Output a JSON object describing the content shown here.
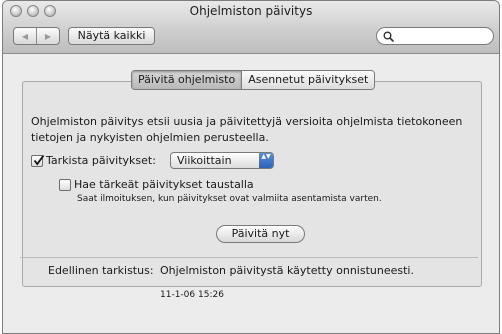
{
  "window": {
    "title": "Ohjelmiston päivitys"
  },
  "toolbar": {
    "back_glyph": "◀",
    "forward_glyph": "▶",
    "show_all_label": "Näytä kaikki",
    "search_value": ""
  },
  "tabs": [
    {
      "label": "Päivitä ohjelmisto",
      "selected": true
    },
    {
      "label": "Asennetut päivitykset",
      "selected": false
    }
  ],
  "update_tab": {
    "description": "Ohjelmiston päivitys etsii uusia ja päivitettyjä versioita ohjelmista tietokoneen tietojen ja nykyisten ohjelmien perusteella.",
    "check_updates": {
      "label": "Tarkista päivitykset:",
      "checked": true
    },
    "frequency": {
      "selected": "Viikoittain",
      "arrows": "▲▼"
    },
    "background_download": {
      "label": "Hae tärkeät päivitykset taustalla",
      "checked": false
    },
    "background_note": "Saat ilmoituksen, kun päivitykset ovat valmiita asentamista varten.",
    "check_now_label": "Päivitä nyt",
    "last_check_label": "Edellinen tarkistus:",
    "last_check_value": "Ohjelmiston päivitystä käytetty onnistuneesti.",
    "last_check_time": "11-1-06 15:26"
  },
  "icons": [
    "close-button",
    "minimize-button",
    "zoom-button",
    "back-arrow-icon",
    "forward-arrow-icon",
    "search-icon",
    "checkmark-icon",
    "popup-arrows-icon"
  ]
}
